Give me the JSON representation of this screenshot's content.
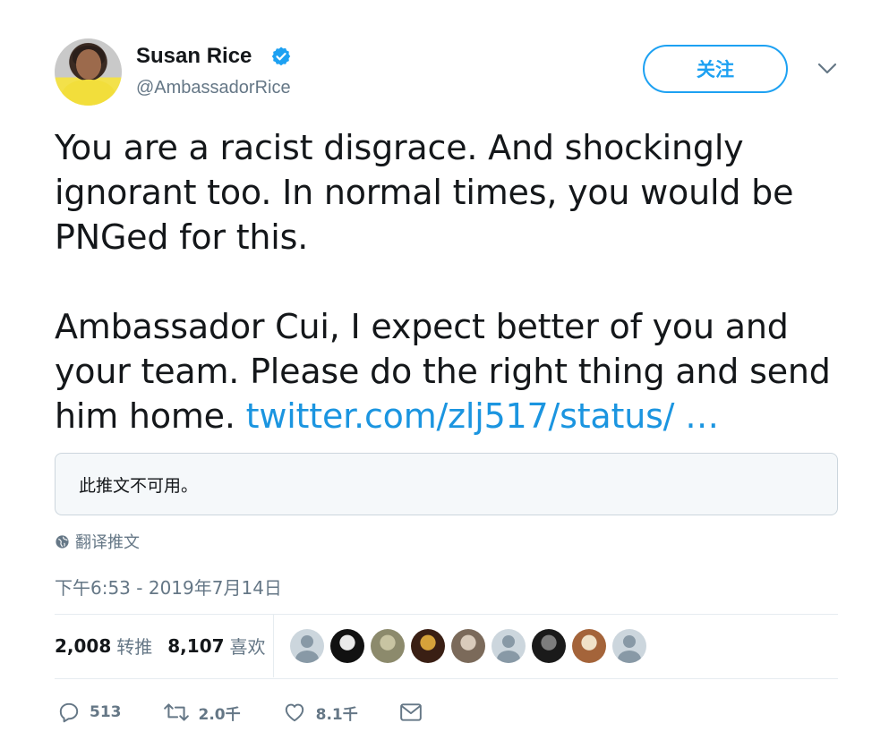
{
  "user": {
    "name": "Susan Rice",
    "handle": "@AmbassadorRice",
    "verified_color": "#1da1f2"
  },
  "header": {
    "follow_label": "关注",
    "more_icon": "chevron-down-icon"
  },
  "tweet": {
    "text": "You are a racist disgrace. And shockingly\nignorant too. In normal times, you would be\nPNGed for this.\n\nAmbassador Cui, I expect better of you and\nyour team. Please do the right thing and send\nhim home. ",
    "link": "twitter.com/zlj517/status/ …",
    "unavailable_text": "此推文不可用。",
    "translate_label": "翻译推文",
    "timestamp": "下午6:53 - 2019年7月14日"
  },
  "stats": {
    "retweets_count": "2,008",
    "retweets_label": "转推",
    "likes_count": "8,107",
    "likes_label": "喜欢"
  },
  "likers": [
    {
      "type": "default"
    },
    {
      "type": "photo",
      "colors": [
        "#111111",
        "#e9e9e9"
      ]
    },
    {
      "type": "photo",
      "colors": [
        "#8c8a6c",
        "#c8c4a2"
      ]
    },
    {
      "type": "photo",
      "colors": [
        "#3a1f14",
        "#d6a23a"
      ]
    },
    {
      "type": "photo",
      "colors": [
        "#7b6a5a",
        "#d9cbbb"
      ]
    },
    {
      "type": "default"
    },
    {
      "type": "photo",
      "colors": [
        "#1a1a1a",
        "#7d7d7d"
      ]
    },
    {
      "type": "photo",
      "colors": [
        "#a4643a",
        "#f0e2c8"
      ]
    },
    {
      "type": "default"
    }
  ],
  "actions": {
    "reply_count": "513",
    "retweet_count": "2.0千",
    "like_count": "8.1千"
  },
  "colors": {
    "accent": "#1da1f2",
    "link": "#1b95e0",
    "secondary_text": "#657786"
  }
}
